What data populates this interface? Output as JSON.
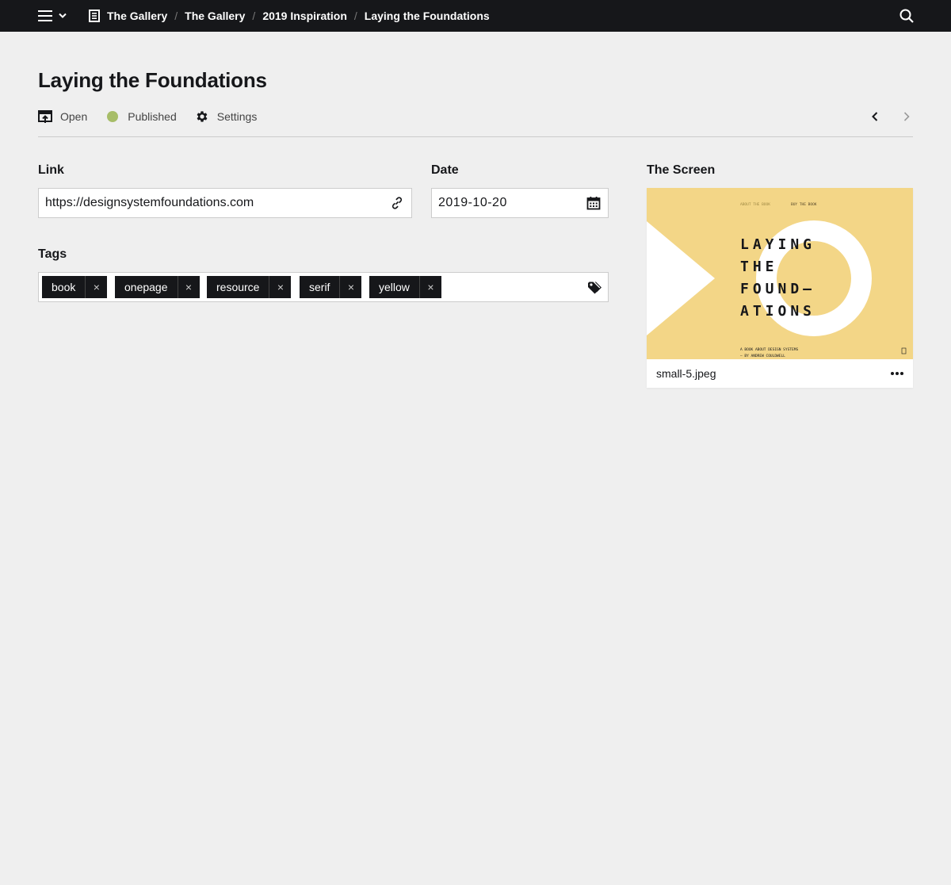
{
  "topbar": {
    "breadcrumbs": [
      "The Gallery",
      "The Gallery",
      "2019 Inspiration",
      "Laying the Foundations"
    ],
    "separator": "/"
  },
  "page": {
    "title": "Laying the Foundations",
    "options": {
      "open": "Open",
      "status": "Published",
      "status_color": "#a7bd68",
      "settings": "Settings"
    }
  },
  "fields": {
    "link": {
      "label": "Link",
      "value": "https://designsystemfoundations.com",
      "icon": "link-icon"
    },
    "date": {
      "label": "Date",
      "value": "2019-10-20",
      "icon": "calendar-icon"
    },
    "tags": {
      "label": "Tags",
      "items": [
        "book",
        "onepage",
        "resource",
        "serif",
        "yellow"
      ],
      "remove": "×",
      "icon": "tag-icon"
    }
  },
  "screen": {
    "label": "The Screen",
    "filename": "small-5.jpeg",
    "preview": {
      "nav_left": "ABOUT THE BOOK",
      "nav_right": "BUY THE BOOK",
      "lines": [
        "LAYING",
        "THE",
        "FOUND—",
        "ATIONS"
      ],
      "sub1": "A BOOK ABOUT DESIGN SYSTEMS",
      "sub2": "— BY ANDREW COULDWELL",
      "bg_color": "#f3d687"
    }
  },
  "colors": {
    "topbar": "#16171a",
    "background": "#efefef",
    "accent": "#a7bd68"
  }
}
